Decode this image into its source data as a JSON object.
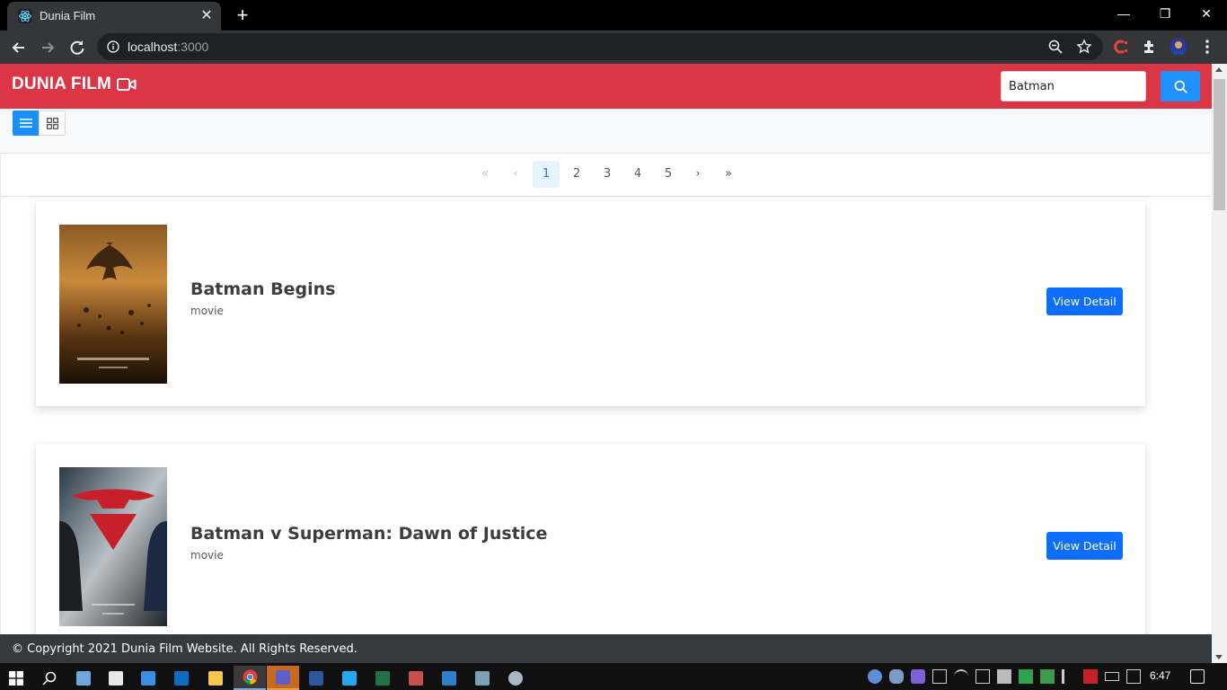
{
  "browser": {
    "tab_title": "Dunia Film",
    "tab_close": "✕",
    "new_tab": "+",
    "url_host": "localhost",
    "url_port": ":3000"
  },
  "window_controls": {
    "minimize": "—",
    "restore": "❐",
    "close": "✕"
  },
  "navbar": {
    "brand": "DUNIA FILM",
    "search_value": "Batman"
  },
  "pagination": {
    "first": "«",
    "prev": "‹",
    "pages": [
      "1",
      "2",
      "3",
      "4",
      "5"
    ],
    "next": "›",
    "last": "»"
  },
  "movies": [
    {
      "title": "Batman Begins",
      "type": "movie",
      "button": "View Detail"
    },
    {
      "title": "Batman v Superman: Dawn of Justice",
      "type": "movie",
      "button": "View Detail"
    }
  ],
  "footer": {
    "text": "© Copyright 2021 Dunia Film Website. All Rights Reserved."
  },
  "taskbar": {
    "clock": "6:47"
  },
  "colors": {
    "brand": "#dc3545",
    "primary": "#0d6efd",
    "accent": "#1890ff",
    "footer": "#343a40"
  }
}
